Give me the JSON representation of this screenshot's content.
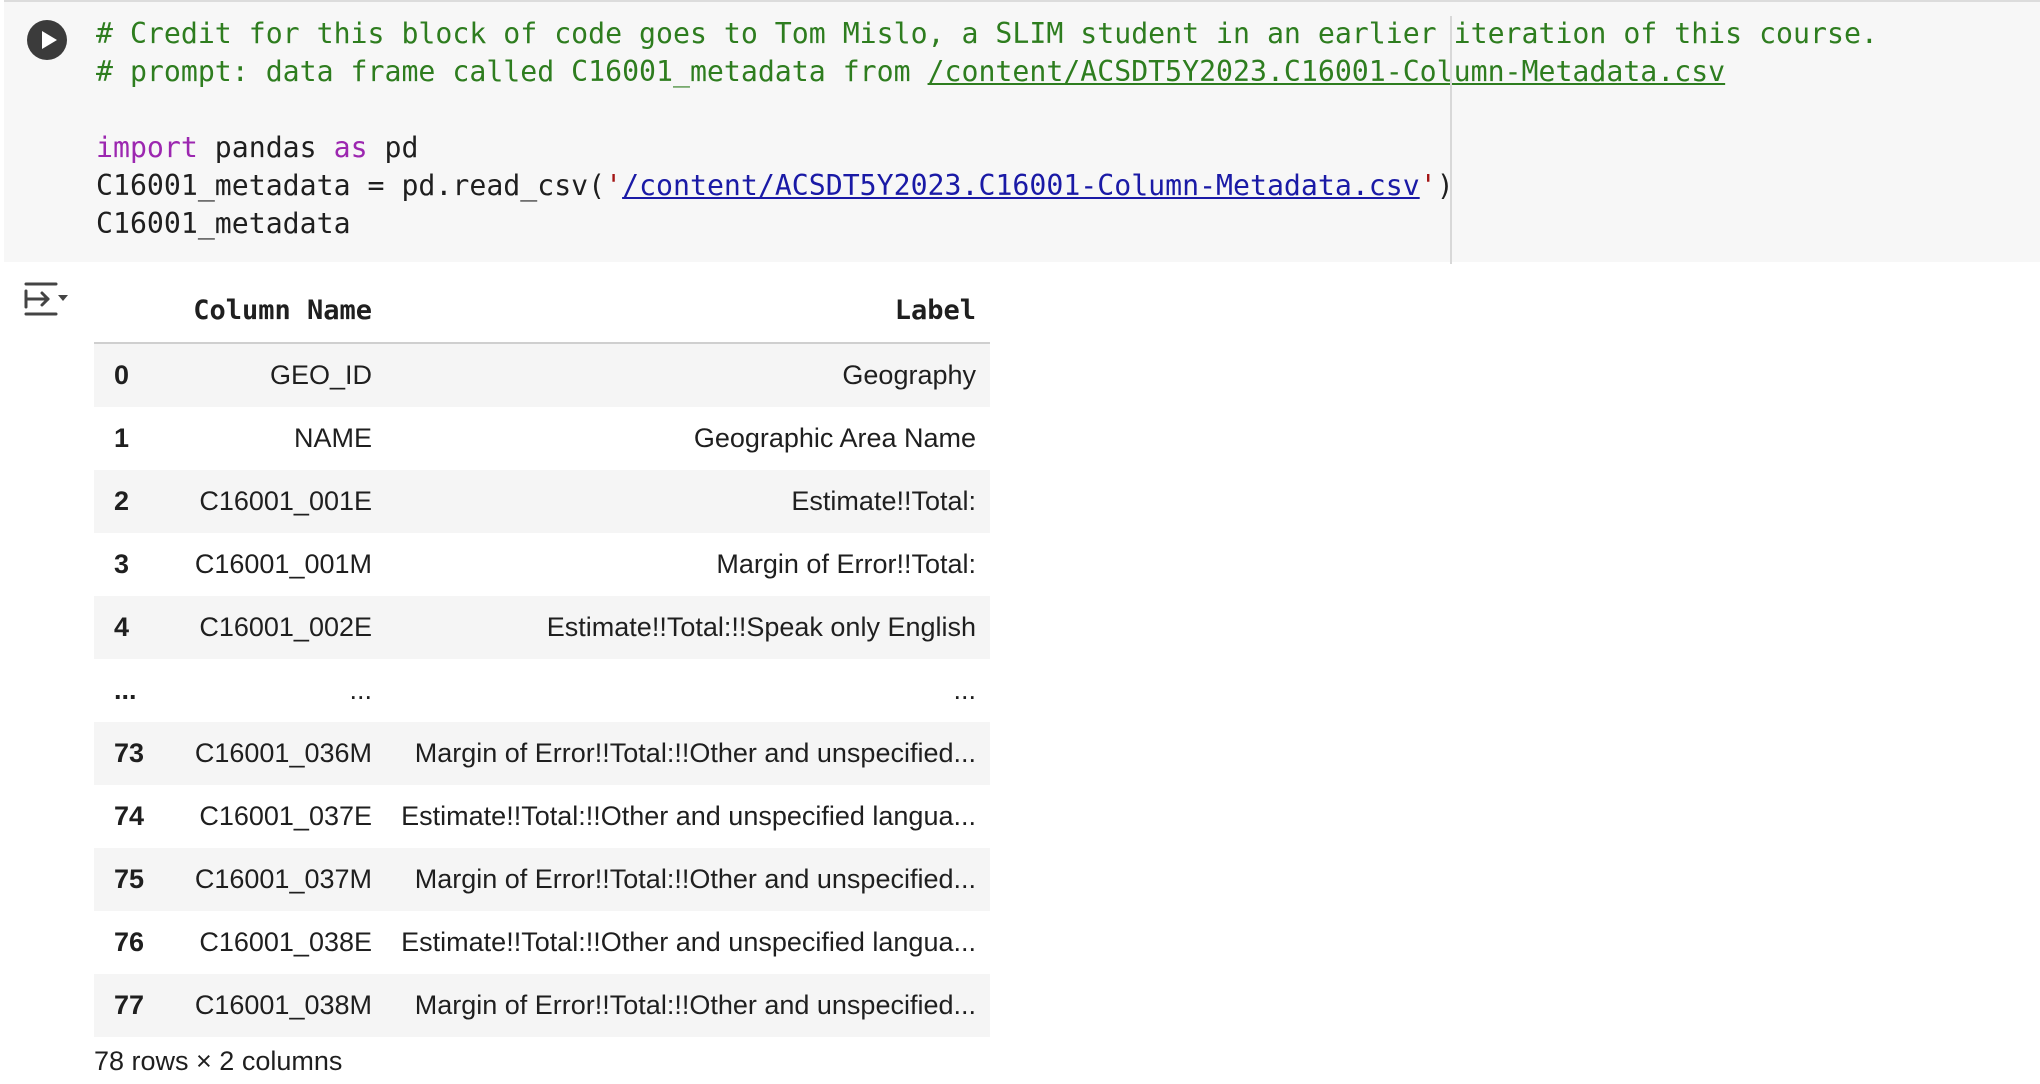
{
  "code_cell": {
    "lines": [
      {
        "type": "comment",
        "text": "# Credit for this block of code goes to Tom Mislo, a SLIM student in an earlier iteration of this course."
      },
      {
        "type": "comment_link",
        "prefix": "# prompt: data frame called C16001_metadata from ",
        "link": "/content/ACSDT5Y2023.C16001-Column-Metadata.csv"
      },
      {
        "type": "blank",
        "text": ""
      },
      {
        "type": "import",
        "kw1": "import",
        "mid1": " pandas ",
        "kw2": "as",
        "mid2": " pd"
      },
      {
        "type": "call",
        "prefix": "C16001_metadata = pd.read_csv(",
        "quote_open": "'",
        "link": "/content/ACSDT5Y2023.C16001-Column-Metadata.csv",
        "quote_close": "'",
        "suffix": ")"
      },
      {
        "type": "plain",
        "text": "C16001_metadata"
      }
    ],
    "run_icon": "play-icon"
  },
  "output": {
    "toggle_icon": "output-toggle-icon",
    "table": {
      "columns": [
        "Column Name",
        "Label"
      ],
      "rows": [
        {
          "index": "0",
          "column_name": "GEO_ID",
          "label": "Geography"
        },
        {
          "index": "1",
          "column_name": "NAME",
          "label": "Geographic Area Name"
        },
        {
          "index": "2",
          "column_name": "C16001_001E",
          "label": "Estimate!!Total:"
        },
        {
          "index": "3",
          "column_name": "C16001_001M",
          "label": "Margin of Error!!Total:"
        },
        {
          "index": "4",
          "column_name": "C16001_002E",
          "label": "Estimate!!Total:!!Speak only English"
        },
        {
          "index": "...",
          "column_name": "...",
          "label": "..."
        },
        {
          "index": "73",
          "column_name": "C16001_036M",
          "label": "Margin of Error!!Total:!!Other and unspecified..."
        },
        {
          "index": "74",
          "column_name": "C16001_037E",
          "label": "Estimate!!Total:!!Other and unspecified langua..."
        },
        {
          "index": "75",
          "column_name": "C16001_037M",
          "label": "Margin of Error!!Total:!!Other and unspecified..."
        },
        {
          "index": "76",
          "column_name": "C16001_038E",
          "label": "Estimate!!Total:!!Other and unspecified langua..."
        },
        {
          "index": "77",
          "column_name": "C16001_038M",
          "label": "Margin of Error!!Total:!!Other and unspecified..."
        }
      ]
    },
    "shape": "78 rows × 2 columns"
  },
  "colors": {
    "comment": "#2e7d1f",
    "keyword": "#9c27b0",
    "link": "#1a1aa6",
    "cell_background": "#f7f7f7"
  }
}
